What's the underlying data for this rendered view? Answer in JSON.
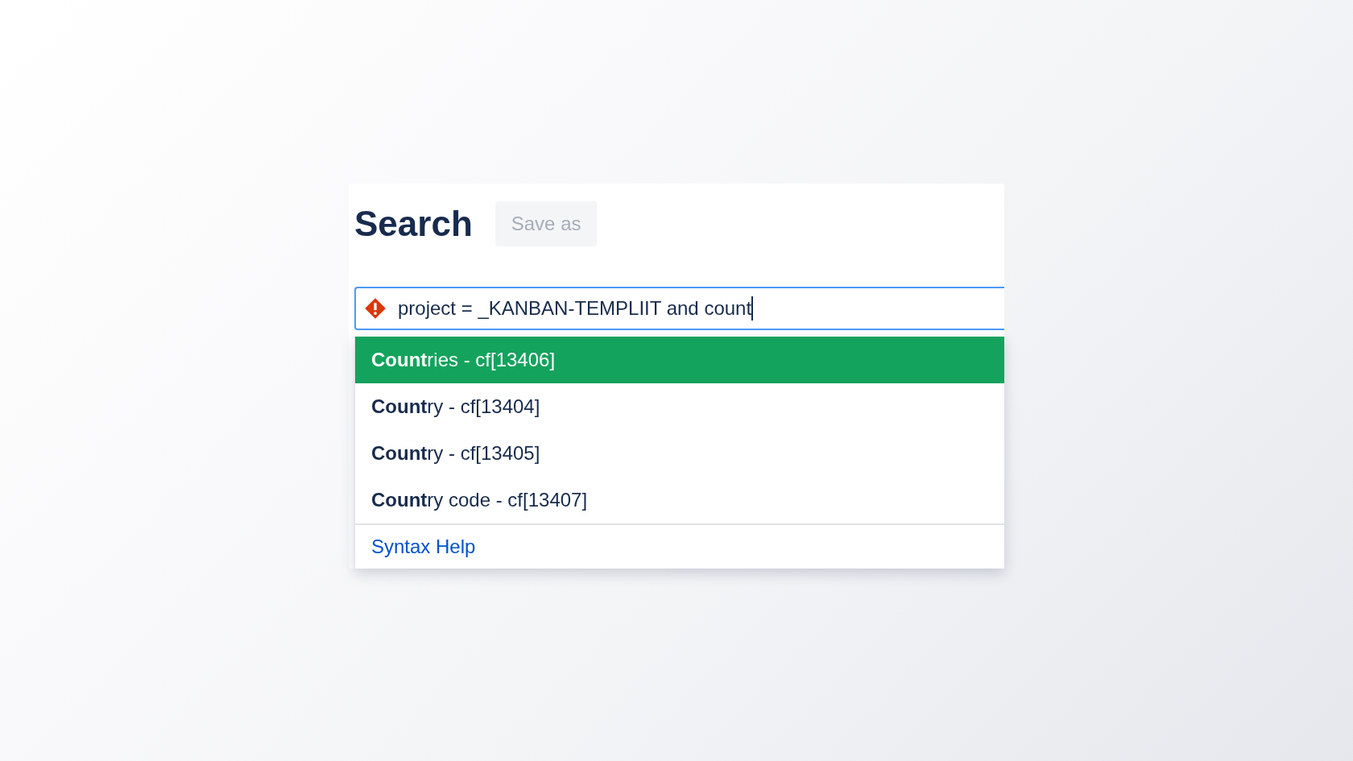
{
  "header": {
    "title": "Search",
    "save_button": {
      "label": "Save as",
      "disabled": true
    }
  },
  "query": {
    "value": "project = _KANBAN-TEMPLIIT and count",
    "error": true
  },
  "suggestions": [
    {
      "label": "**Count**ries - cf[13406]",
      "selected": true
    },
    {
      "label": "**Count**ry - cf[13404]",
      "selected": false
    },
    {
      "label": "**Count**ry - cf[13405]",
      "selected": false
    },
    {
      "label": "**Count**ry code - cf[13407]",
      "selected": false
    }
  ],
  "footer_link": "Syntax Help"
}
